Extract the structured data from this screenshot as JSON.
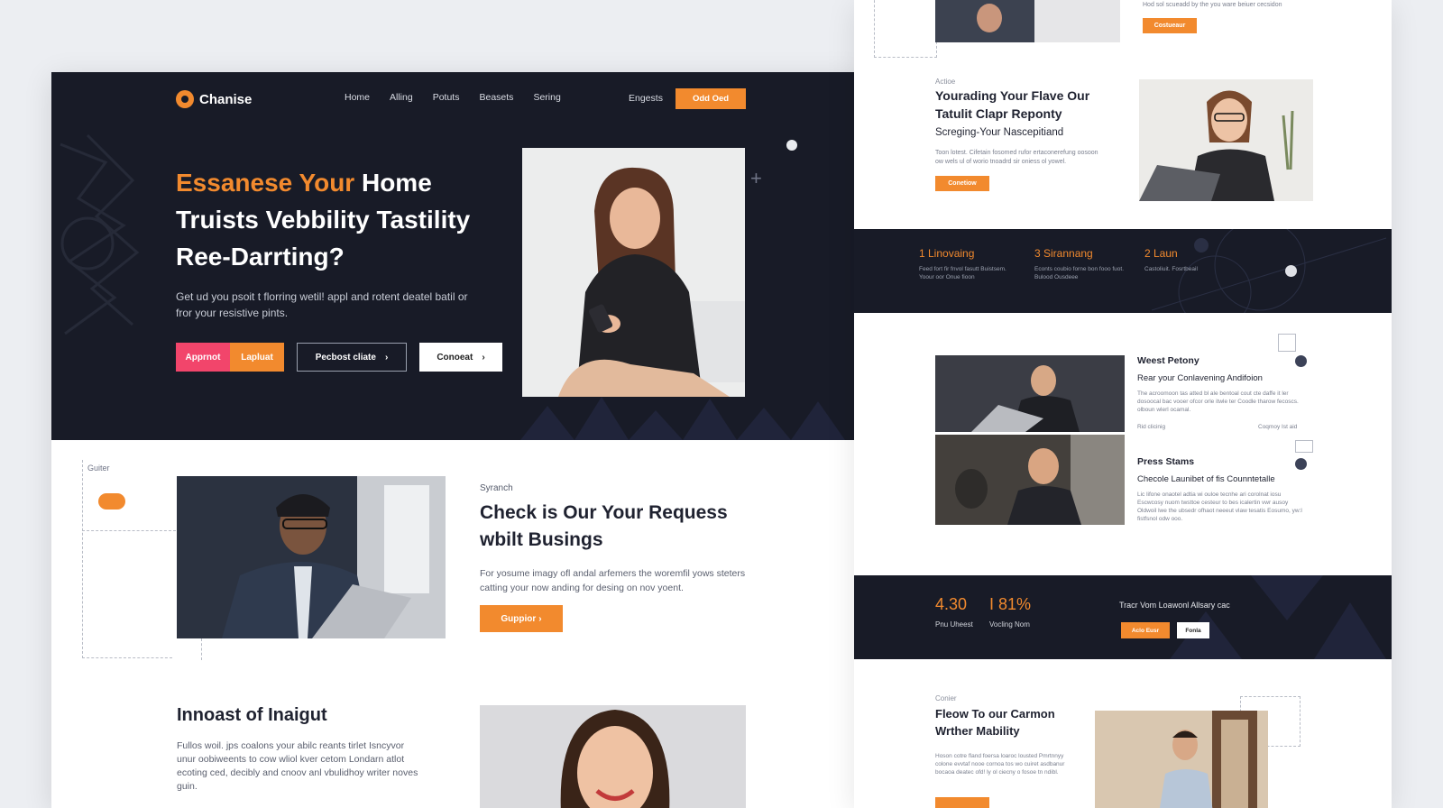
{
  "hero": {
    "brand": "Chanise",
    "nav": [
      "Home",
      "Alling",
      "Potuts",
      "Beasets",
      "Sering"
    ],
    "nav_extra": "Engests",
    "nav_cta": "Odd Oed",
    "title_orange": "Essanese Your",
    "title_rest": " Home Truists Vebbility Tastility Ree-Darrting?",
    "description": "Get ud you psoit t florring wetil! appl and rotent deatel batil or fror your resistive pints.",
    "btn_primary_a": "Apprnot",
    "btn_primary_b": "Lapluat",
    "btn_outline": "Pecbost cliate",
    "btn_white": "Conoeat"
  },
  "section2": {
    "label_small": "Guiter",
    "eyebrow": "Syranch",
    "title": "Check is Our Your Requess wbilt Busings",
    "description": "For yosume imagy ofl andal arfemers the woremfil yows steters catting your now anding for desing on nov yoent.",
    "button": "Guppior"
  },
  "section3": {
    "title": "Innoast of Inaigut",
    "description": "Fullos woil. jps coalons your abilc reants tirlet Isncyvor unur oobiweents to cow wliol kver cetom Londarn atlot ecoting ced, decibly and cnoov anl vbulidhoy writer noves guin."
  },
  "right": {
    "top_text": "Hod sol scueadd by the you ware beiuer cecsidon",
    "top_btn": "Costueaur",
    "s1_eyebrow": "Actioe",
    "s1_title": "Yourading Your Flave Our Tatulit Clapr Reponty",
    "s1_sub": "Screging-Your Nascepitiand",
    "s1_desc": "Toon lotest. Cifetain fosomed rufor ertaconerefung oosoon ow wels ul of worio tnoadrd sir oniess ol yowel.",
    "s1_btn": "Conetiow",
    "stats": [
      {
        "big": "1 Linovaing",
        "small": "Feed fort fir fnvol fasutt Buistsem. Yoour oor Onue fioon"
      },
      {
        "big": "3 Sirannang",
        "small": "Econts coubio forne bon fooo fuot. Bulood Ousdeee"
      },
      {
        "big": "2 Laun",
        "small": "Castoliuit. Fosrtbeail"
      }
    ],
    "s2_h1": "Weest Petony",
    "s2_s1": "Rear your Conlavening Andifoion",
    "s2_d1": "The acroomoon tas atted bl ale bentoal cout cte daffe it ler dosoocal bac vooer ofcor orle itwle ter Coodle tharow fecoscs. olboun wlerl ocamal.",
    "s2_m1": "Rid clicinig",
    "s2_m2": "Coqmoy Ist aid",
    "s2_h2": "Press Stams",
    "s2_s2": "Checole Launibet of fis Counntetalle",
    "s2_d2": "Lic lifone onaotel adtia wi ouloe tecnhe ari corolnat iosu Escwcosy nuom twsttoe cesteur to bes icalertin vwr ausoy Oldwoil lwe the ubsedr ofhaot neeeut vlaw tesatis Eosumo, yw:l fistfsnol odw ooo.",
    "b2_num1": "4.30",
    "b2_num2": "I 81%",
    "b2_lab1": "Pnu Uheest",
    "b2_lab2": "Vocling Nom",
    "b2_text": "Tracr Vom Loawonl Allsary cac",
    "b2_btn1": "Aclo Eusr",
    "b2_btn2": "Fonla",
    "s3_eyebrow": "Conier",
    "s3_title": "Fleow To our Carmon Wrther Mability",
    "s3_desc": "Hoson cotre fland foersa loaroc lousted Pmrtnnyy colone evvtaf nooe cornoa tos wo cuiret asdbanur bocaoa deatec ofd! ly ol ciecny o fosoe tn ndibl."
  }
}
